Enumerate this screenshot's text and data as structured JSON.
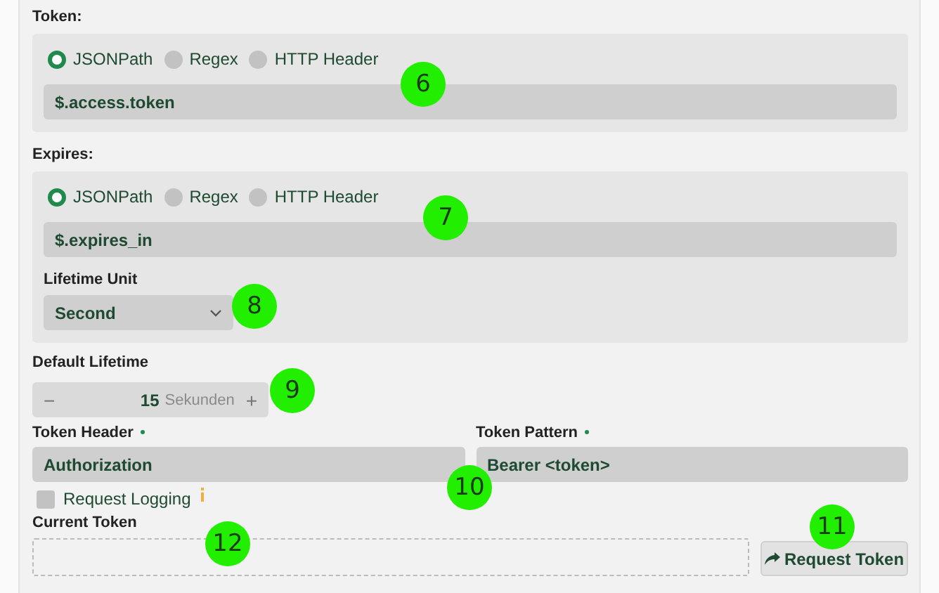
{
  "sections": [
    {
      "label": "Token:",
      "options": [
        {
          "label": "JSONPath",
          "selected": true
        },
        {
          "label": "Regex",
          "selected": false
        },
        {
          "label": "HTTP Header",
          "selected": false
        }
      ],
      "value": "$.access.token"
    },
    {
      "label": "Expires:",
      "options": [
        {
          "label": "JSONPath",
          "selected": true
        },
        {
          "label": "Regex",
          "selected": false
        },
        {
          "label": "HTTP Header",
          "selected": false
        }
      ],
      "value": "$.expires_in",
      "unit": {
        "label": "Lifetime Unit",
        "value": "Second"
      }
    }
  ],
  "default_lifetime": {
    "label": "Default Lifetime",
    "minus": "−",
    "value": "15",
    "unit": "Sekunden",
    "plus": "+"
  },
  "token_header": {
    "label": "Token Header",
    "required": true,
    "value": "Authorization"
  },
  "token_pattern": {
    "label": "Token Pattern",
    "required": true,
    "value": "Bearer <token>"
  },
  "request_logging": {
    "label": "Request Logging",
    "checked": false
  },
  "current_token": {
    "label": "Current Token"
  },
  "request_button": {
    "label": "Request Token"
  },
  "callouts": [
    {
      "number": "6"
    },
    {
      "number": "7"
    },
    {
      "number": "8"
    },
    {
      "number": "9"
    },
    {
      "number": "10"
    },
    {
      "number": "11"
    },
    {
      "number": "12"
    }
  ]
}
